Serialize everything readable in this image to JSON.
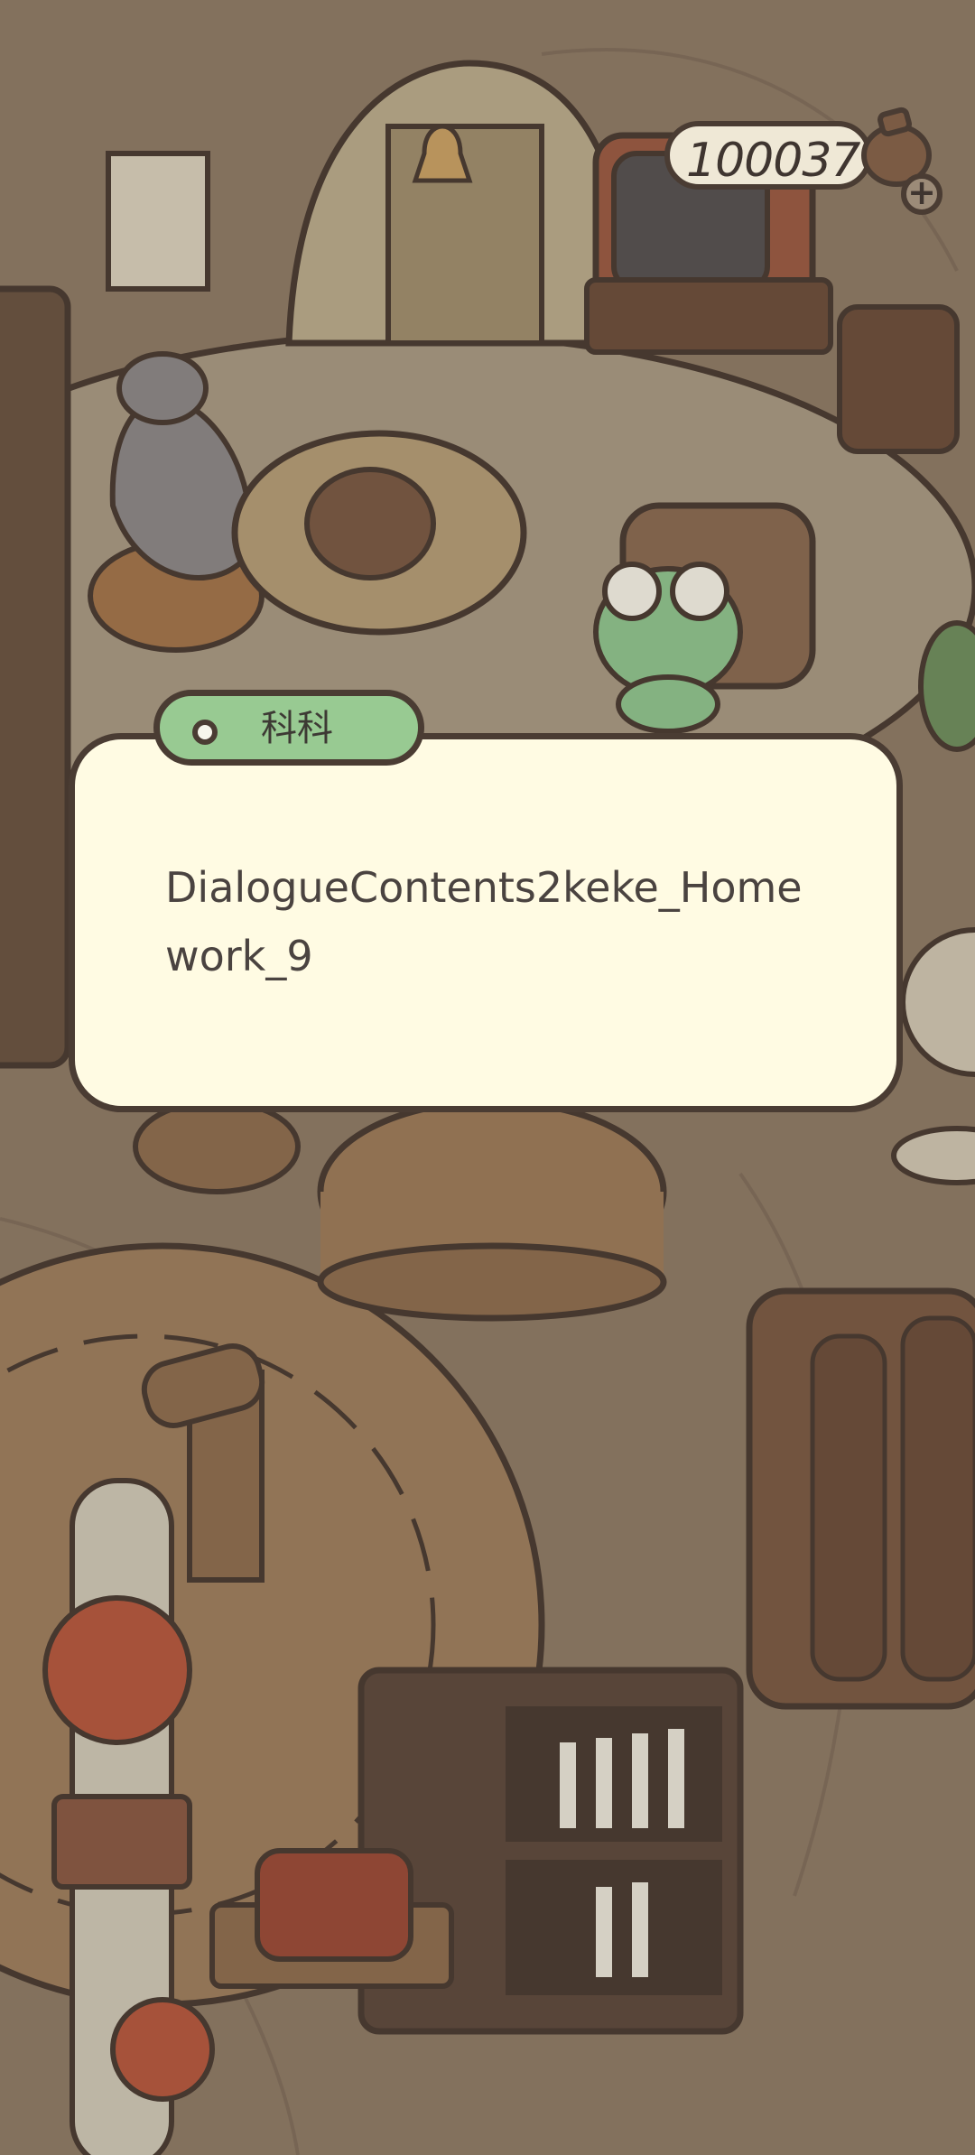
{
  "hud": {
    "coin_count": "100037",
    "coin_icon": "coin-bag-icon",
    "add_icon": "plus-icon"
  },
  "dialogue": {
    "speaker": "科科",
    "text": "DialogueContents2keke_Homework_9"
  },
  "colors": {
    "dialogue_bg": "#fffbe3",
    "name_tag": "#98ca92",
    "outline": "#4a3c33",
    "scene_bg": "#8e7b66"
  }
}
